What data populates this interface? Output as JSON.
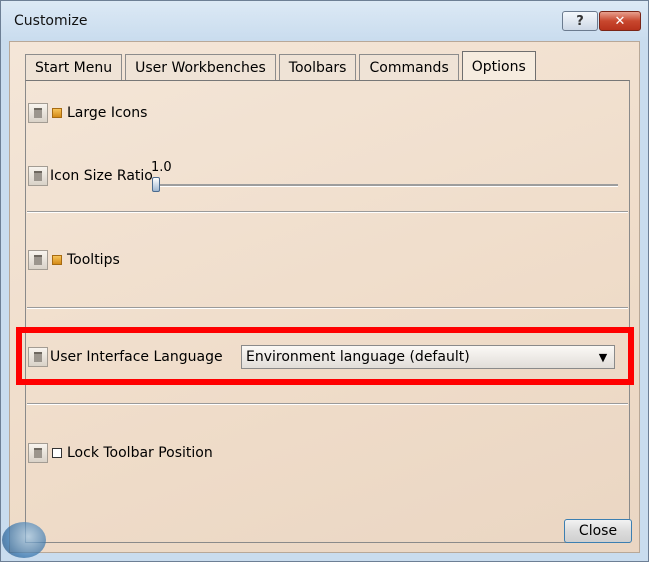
{
  "window": {
    "title": "Customize",
    "help_label": "?",
    "close_label": "✕"
  },
  "tabs": [
    {
      "label": "Start Menu",
      "active": false
    },
    {
      "label": "User Workbenches",
      "active": false
    },
    {
      "label": "Toolbars",
      "active": false
    },
    {
      "label": "Commands",
      "active": false
    },
    {
      "label": "Options",
      "active": true
    }
  ],
  "options": {
    "large_icons": {
      "label": "Large Icons",
      "checked": true
    },
    "icon_size_ratio": {
      "label": "Icon Size Ratio",
      "value": "1.0"
    },
    "tooltips": {
      "label": "Tooltips",
      "checked": true
    },
    "ui_language": {
      "label": "User Interface Language",
      "selected": "Environment language (default)"
    },
    "lock_toolbar": {
      "label": "Lock Toolbar Position",
      "checked": false
    }
  },
  "footer": {
    "close_label": "Close"
  },
  "colors": {
    "highlight": "#ff0000",
    "client_bg": "#efdcc9",
    "checkbox_on": "#e0a030"
  }
}
